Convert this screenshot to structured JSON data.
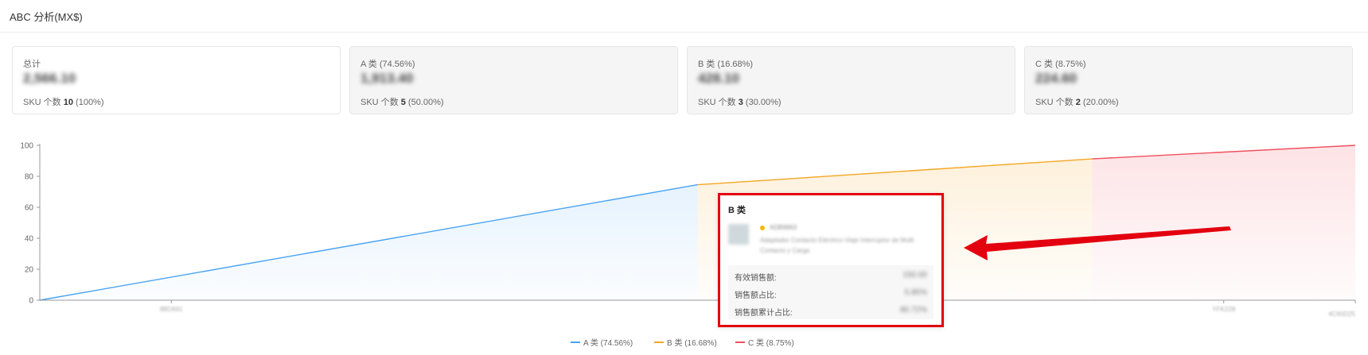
{
  "header": {
    "title": "ABC 分析(MX$)"
  },
  "cards": [
    {
      "label": "总计",
      "value": "2,566.10",
      "sku_prefix": "SKU 个数 ",
      "sku_count": "10",
      "sku_pct": " (100%)"
    },
    {
      "label": "A 类 (74.56%)",
      "value": "1,913.40",
      "sku_prefix": "SKU 个数 ",
      "sku_count": "5",
      "sku_pct": " (50.00%)"
    },
    {
      "label": "B 类 (16.68%)",
      "value": "428.10",
      "sku_prefix": "SKU 个数 ",
      "sku_count": "3",
      "sku_pct": " (30.00%)"
    },
    {
      "label": "C 类 (8.75%)",
      "value": "224.60",
      "sku_prefix": "SKU 个数 ",
      "sku_count": "2",
      "sku_pct": " (20.00%)"
    }
  ],
  "chart_data": {
    "type": "area",
    "ylim": [
      0,
      100
    ],
    "yticks": [
      "0",
      "20",
      "40",
      "60",
      "80",
      "100"
    ],
    "xlabel": "",
    "ylabel": "",
    "x_tick_labels": [
      "8BD691",
      "YFK228",
      "4C60D25"
    ],
    "series": [
      {
        "name": "A 类 (74.56%)",
        "color": "#4aa3f2",
        "x": [
          0,
          5
        ],
        "y": [
          0,
          74.56
        ]
      },
      {
        "name": "B 类 (16.68%)",
        "color": "#f5a623",
        "x": [
          5,
          8
        ],
        "y": [
          74.56,
          91.24
        ]
      },
      {
        "name": "C 类 (8.75%)",
        "color": "#f0505f",
        "x": [
          8,
          10
        ],
        "y": [
          91.24,
          100
        ]
      }
    ]
  },
  "tooltip": {
    "title": "B 类",
    "sku": "ADB9963",
    "product_name": "Adaptador Contacto Eléctrico Viaje Interruptor de Multi Contacto y Carga",
    "image_alt": "图片",
    "rows": [
      {
        "label": "有效销售额:",
        "value": "150.00"
      },
      {
        "label": "销售额占比:",
        "value": "5.85%"
      },
      {
        "label": "销售额累计占比:",
        "value": "80.72%"
      }
    ]
  },
  "annotation": {
    "color": "#e3000f"
  }
}
